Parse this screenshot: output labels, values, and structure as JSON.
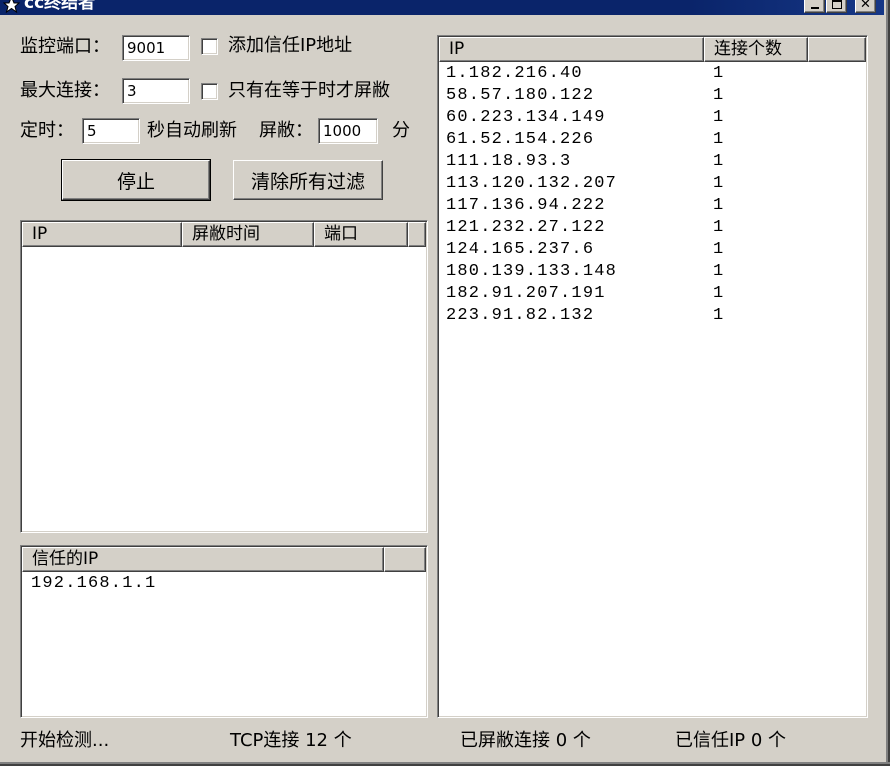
{
  "window": {
    "title": "cc终结者",
    "icon": "app-icon",
    "controls": [
      "minimize-icon",
      "maximize-icon",
      "close-icon"
    ]
  },
  "settings": {
    "port_label": "监控端口：",
    "port_value": "9001",
    "trust_checkbox_label": "添加信任IP地址",
    "trust_checked": false,
    "max_conn_label": "最大连接：",
    "max_conn_value": "3",
    "equal_checkbox_label": "只有在等于时才屏敝",
    "equal_checked": false,
    "timer_label": "定时：",
    "timer_value": "5",
    "refresh_label": "秒自动刷新",
    "block_label": "屏敝：",
    "block_value": "1000",
    "minutes_label": "分"
  },
  "buttons": {
    "stop": "停止",
    "clear": "清除所有过滤"
  },
  "blocked_list": {
    "columns": [
      "IP",
      "屏敝时间",
      "端口"
    ],
    "rows": []
  },
  "trusted_list": {
    "columns": [
      "信任的IP"
    ],
    "rows": [
      "192.168.1.1"
    ]
  },
  "connections_list": {
    "columns": [
      "IP",
      "连接个数"
    ],
    "rows": [
      {
        "ip": "1.182.216.40",
        "count": "1"
      },
      {
        "ip": "58.57.180.122",
        "count": "1"
      },
      {
        "ip": "60.223.134.149",
        "count": "1"
      },
      {
        "ip": "61.52.154.226",
        "count": "1"
      },
      {
        "ip": "111.18.93.3",
        "count": "1"
      },
      {
        "ip": "113.120.132.207",
        "count": "1"
      },
      {
        "ip": "117.136.94.222",
        "count": "1"
      },
      {
        "ip": "121.232.27.122",
        "count": "1"
      },
      {
        "ip": "124.165.237.6",
        "count": "1"
      },
      {
        "ip": "180.139.133.148",
        "count": "1"
      },
      {
        "ip": "182.91.207.191",
        "count": "1"
      },
      {
        "ip": "223.91.82.132",
        "count": "1"
      }
    ]
  },
  "status": {
    "detect": "开始检测...",
    "tcp": "TCP连接 12 个",
    "blocked": "已屏敝连接 0 个",
    "trusted": "已信任IP 0 个"
  },
  "colors": {
    "window_bg": "#d4d0c8",
    "title_bg": "#0a246a",
    "list_bg": "#ffffff",
    "text": "#000000"
  }
}
